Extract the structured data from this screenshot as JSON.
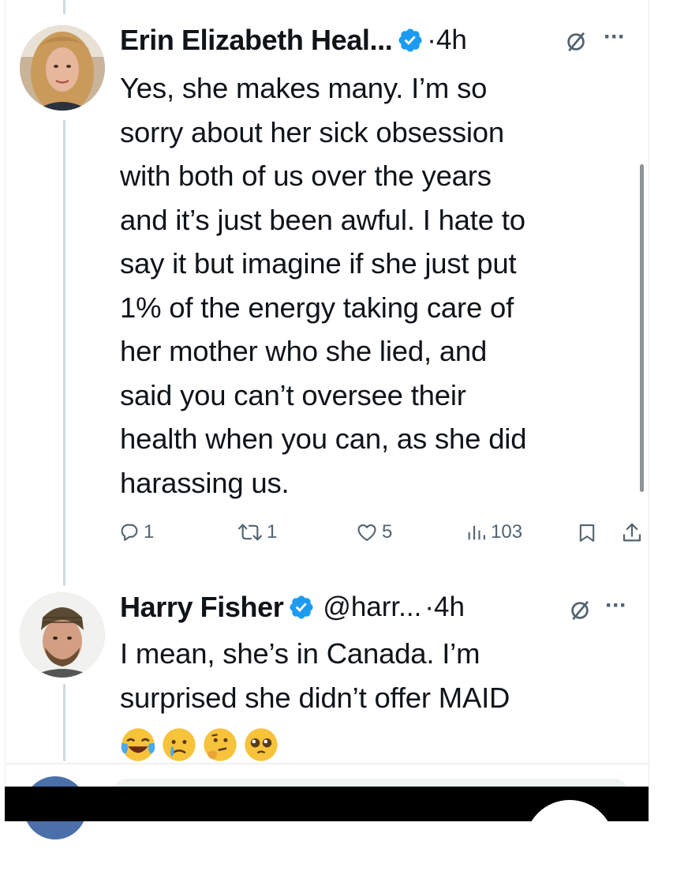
{
  "thread": [
    {
      "author": {
        "name": "Erin Elizabeth Heal...",
        "verified": true,
        "separator": "·",
        "time": "4h"
      },
      "text": "Yes, she makes many. I’m so\nsorry about her sick obsession\nwith both of us over the years\nand it’s just been awful. I hate to\nsay it but imagine if she just put\n1% of the energy taking care of\nher mother who she lied, and\nsaid you can’t oversee their\nhealth when you can, as she did\nharassing us.",
      "stats": {
        "replies": "1",
        "reposts": "1",
        "likes": "5",
        "views": "103"
      }
    },
    {
      "author": {
        "name": "Harry Fisher",
        "verified": true,
        "handle": "@harr...",
        "separator": "·",
        "time": "4h"
      },
      "text": "I mean, she’s in Canada. I’m\nsurprised she didn’t offer MAID",
      "emojis": [
        "face-with-tears-of-joy",
        "crying-face",
        "thinking-face",
        "pleading-face"
      ]
    }
  ],
  "icons": {
    "verified": "verified-badge-icon",
    "grok": "grok-icon",
    "more": "more-icon",
    "reply": "reply-icon",
    "repost": "repost-icon",
    "like": "heart-icon",
    "views": "views-icon",
    "bookmark": "bookmark-icon",
    "share": "share-icon"
  },
  "colors": {
    "verified_blue": "#1d9bf0",
    "text": "#0f1419",
    "secondary": "#536471",
    "thread_line": "#cfd9de"
  }
}
